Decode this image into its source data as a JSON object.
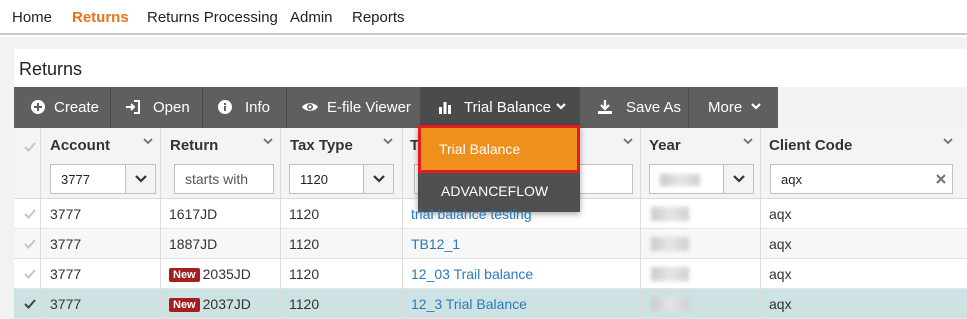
{
  "nav": {
    "items": [
      {
        "label": "Home"
      },
      {
        "label": "Returns"
      },
      {
        "label": "Returns Processing"
      },
      {
        "label": "Admin"
      },
      {
        "label": "Reports"
      }
    ],
    "active": "Returns"
  },
  "panel": {
    "title": "Returns"
  },
  "toolbar": {
    "create": "Create",
    "open": "Open",
    "info": "Info",
    "efile": "E-file Viewer",
    "trial_balance": "Trial Balance",
    "save_as": "Save As",
    "more": "More"
  },
  "dropdown": {
    "items": [
      "Trial Balance",
      "ADVANCEFLOW"
    ]
  },
  "columns": {
    "account": "Account",
    "return": "Return",
    "tax_type": "Tax Type",
    "tax_year_partial": "Ta",
    "year": "Year",
    "client_code": "Client Code"
  },
  "filters": {
    "account": "3777",
    "return_placeholder": "starts with",
    "tax_type": "1120",
    "client_code": "aqx"
  },
  "rows": [
    {
      "account": "3777",
      "badge": "",
      "return": "1617JD",
      "tax_type": "1120",
      "name": "trial balance testing",
      "client": "aqx"
    },
    {
      "account": "3777",
      "badge": "",
      "return": "1887JD",
      "tax_type": "1120",
      "name": "TB12_1",
      "client": "aqx"
    },
    {
      "account": "3777",
      "badge": "New",
      "return": "2035JD",
      "tax_type": "1120",
      "name": "12_03 Trail balance",
      "client": "aqx"
    },
    {
      "account": "3777",
      "badge": "New",
      "return": "2037JD",
      "tax_type": "1120",
      "name": "12_3 Trial Balance",
      "client": "aqx"
    }
  ],
  "colors": {
    "accent": "#e8731b",
    "toolbar": "#5f5f5f",
    "dropdown_highlight": "#ef8f1d",
    "highlight_outline": "#e51c1c",
    "link": "#2a7ab8",
    "badge": "#a61d1d",
    "selected_row": "#cde3e3"
  },
  "icons": {
    "create": "plus-circle-icon",
    "open": "sign-in-icon",
    "info": "info-circle-icon",
    "efile": "eye-icon",
    "trial_balance": "bar-chart-icon",
    "save_as": "download-icon",
    "dropdown": "chevron-down-icon",
    "check": "check-icon",
    "clear": "close-icon"
  }
}
